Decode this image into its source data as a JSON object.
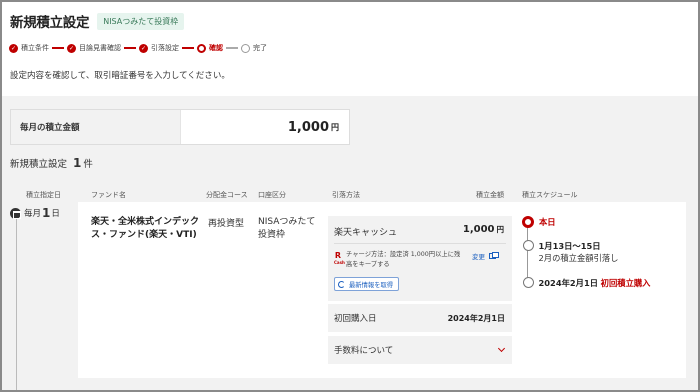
{
  "page": {
    "title": "新規積立設定",
    "tag": "NISAつみたて投資枠",
    "instruction": "設定内容を確認して、取引暗証番号を入力してください。"
  },
  "steps": [
    {
      "label": "積立条件",
      "state": "done"
    },
    {
      "label": "目論見書確認",
      "state": "done"
    },
    {
      "label": "引落設定",
      "state": "done"
    },
    {
      "label": "確認",
      "state": "current"
    },
    {
      "label": "完了",
      "state": "pending"
    }
  ],
  "monthly": {
    "label": "毎月の積立金額",
    "amount": "1,000",
    "unit": "円"
  },
  "count": {
    "prefix": "新規積立設定",
    "number": "1",
    "suffix": "件"
  },
  "columns": {
    "day": "積立指定日",
    "fund": "ファンド名",
    "course": "分配金コース",
    "account": "口座区分",
    "method": "引落方法",
    "amount": "積立金額",
    "schedule": "積立スケジュール"
  },
  "row": {
    "day_prefix": "毎月",
    "day_num": "1",
    "day_suffix": "日",
    "fund_name": "楽天・全米株式インデックス・ファンド(楽天・VTI)",
    "course": "再投資型",
    "account": "NISAつみたて投資枠",
    "method": {
      "name": "楽天キャッシュ",
      "amount": "1,000",
      "unit": "円",
      "logo_text": "R",
      "logo_sub": "Cash",
      "charge_text": "チャージ方法：設定済 1,000円以上に残高をキープする",
      "change_label": "変更",
      "refresh_label": "最新情報を取得"
    },
    "first_buy": {
      "label": "初回購入日",
      "value": "2024年2月1日"
    },
    "fee": {
      "label": "手数料について"
    },
    "schedule": {
      "today": "本日",
      "range": "1月13日〜15日",
      "range_note": "2月の積立金額引落し",
      "first_date": "2024年2月1日",
      "first_label": "初回積立購入"
    }
  },
  "colors": {
    "accent": "#bf0000",
    "link": "#1b5fbf",
    "tag_bg": "#e6f4ee"
  }
}
